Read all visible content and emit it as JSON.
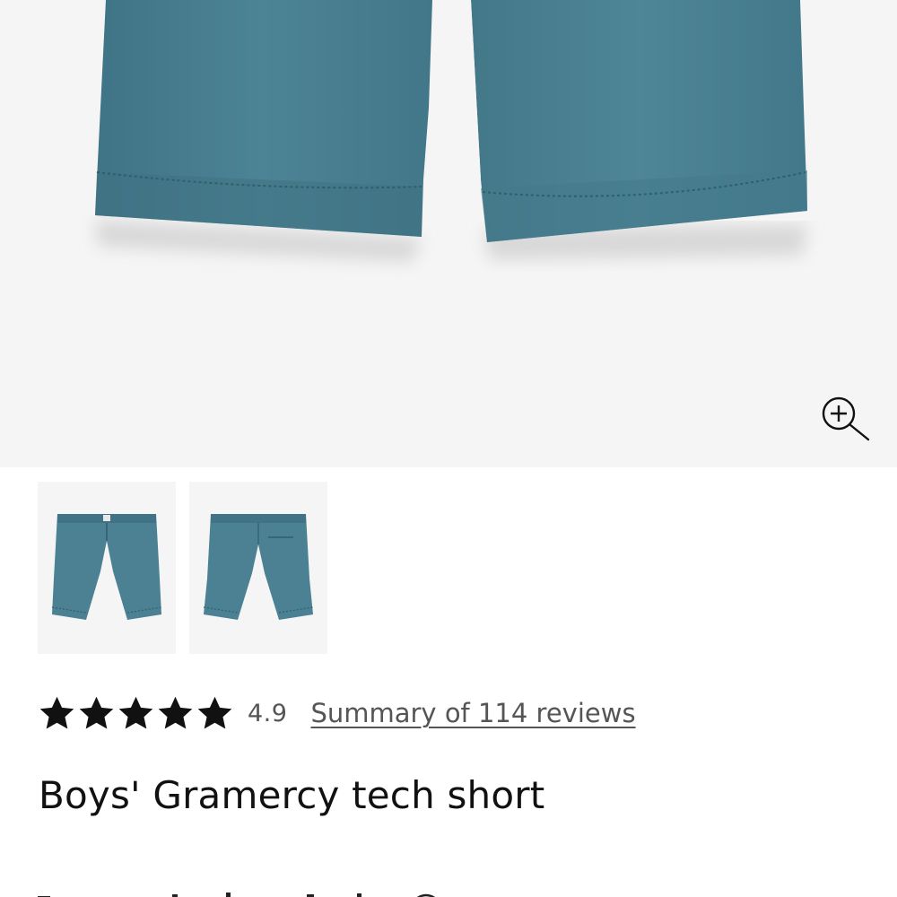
{
  "product": {
    "title": "Boys' Gramercy tech short",
    "color_hex": "#4b8193"
  },
  "gallery": {
    "zoom_icon": "zoom-in-icon",
    "thumbnails": [
      {
        "view": "front",
        "selected": false
      },
      {
        "view": "back",
        "selected": true
      }
    ]
  },
  "rating": {
    "stars": 5,
    "value": "4.9",
    "reviews_link": "Summary of 114 reviews"
  },
  "colors": {
    "background": "#ffffff",
    "image_background": "#f5f5f5",
    "text": "#111111",
    "muted_text": "#555555"
  }
}
